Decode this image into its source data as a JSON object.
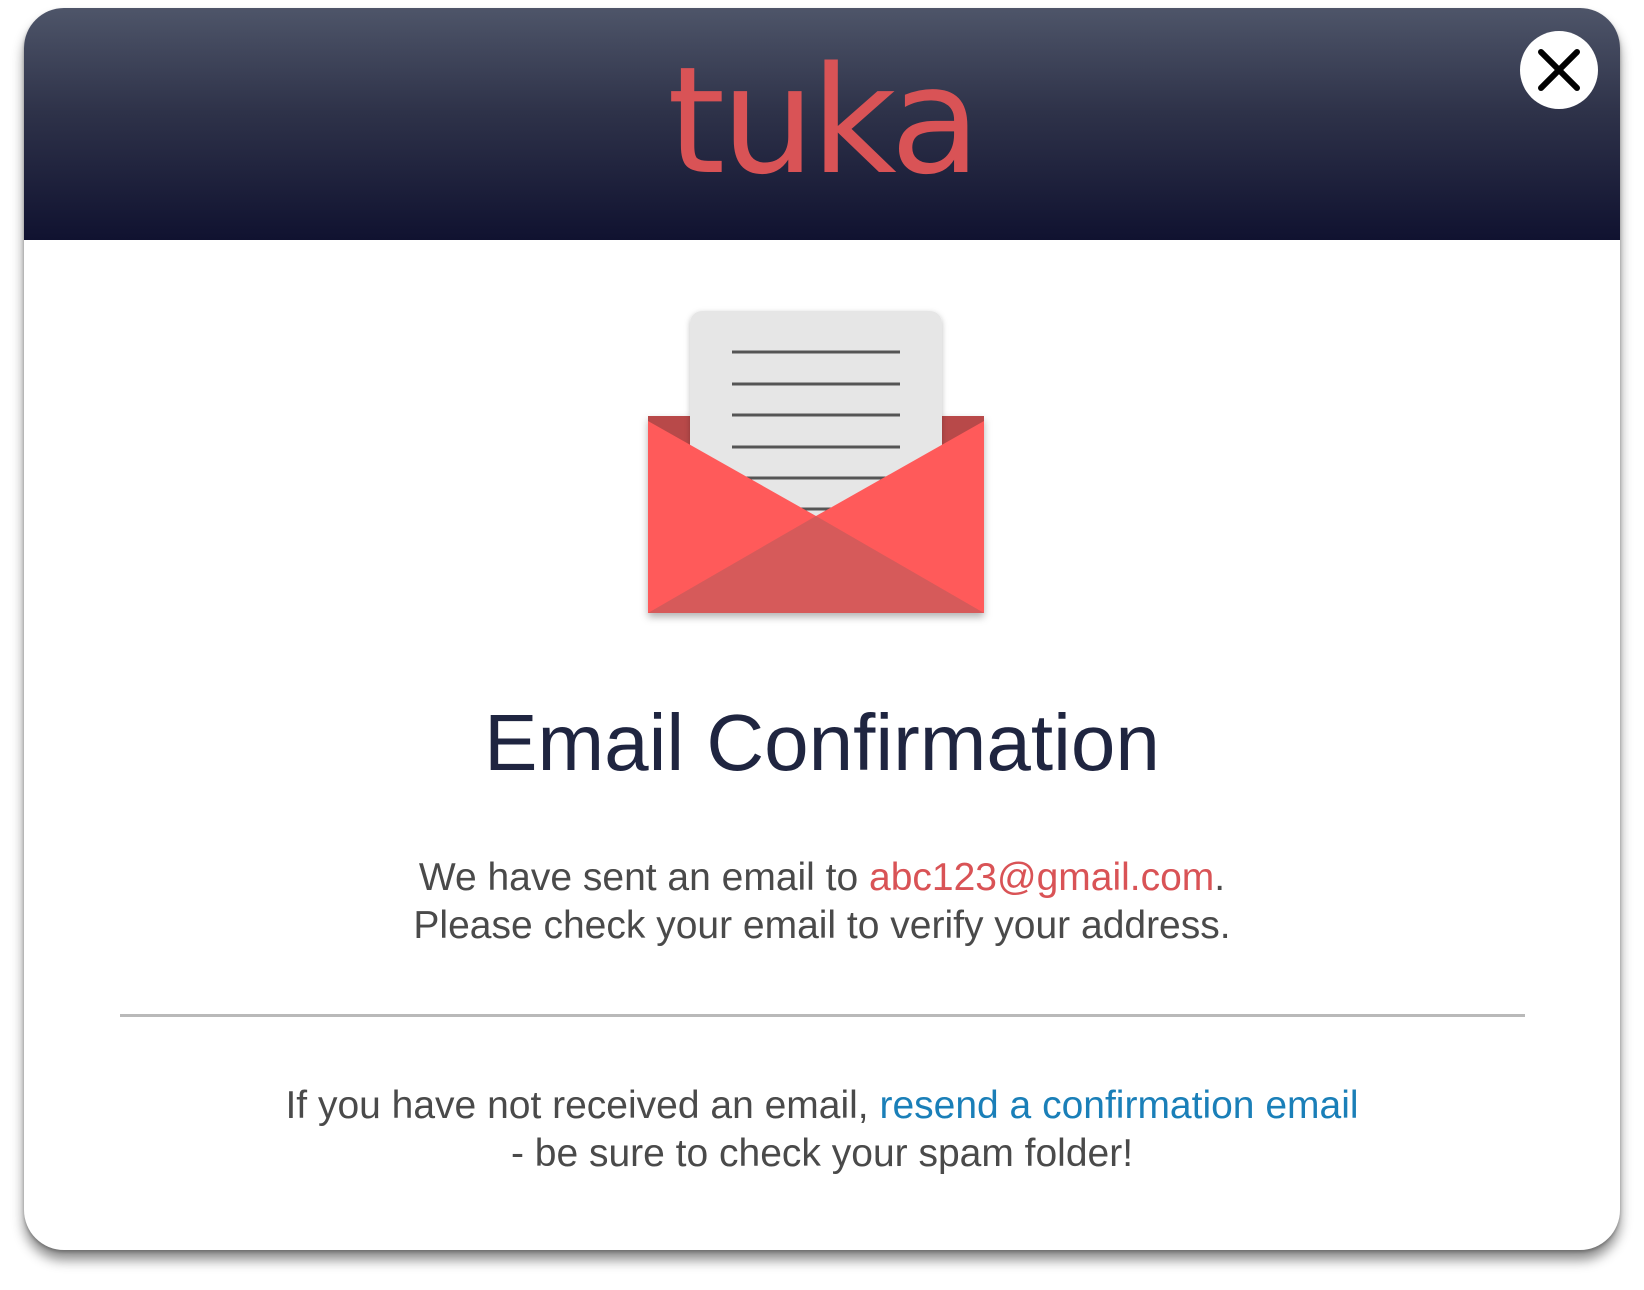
{
  "header": {
    "logo_text": "tuka",
    "close_label": "Close"
  },
  "illustration": {
    "icon": "open-envelope-with-letter",
    "colors": {
      "envelope": "#ff5a5a",
      "envelope_shadow": "#d65a5a",
      "letter": "#e6e6e6"
    }
  },
  "content": {
    "title": "Email Confirmation",
    "message_prefix": "We have sent an email to ",
    "email": "abc123@gmail.com",
    "message_suffix": ".",
    "message_line2": "Please check your email to verify your address.",
    "resend_prefix": "If you have not received an email, ",
    "resend_link": "resend a confirmation email",
    "resend_line2": "- be sure to check your spam folder!"
  },
  "colors": {
    "header_top": "#4e5569",
    "header_bottom": "#101230",
    "brand": "#d95356",
    "link": "#1a7fb8",
    "title": "#1f2540",
    "body_text": "#4a4a4a"
  }
}
